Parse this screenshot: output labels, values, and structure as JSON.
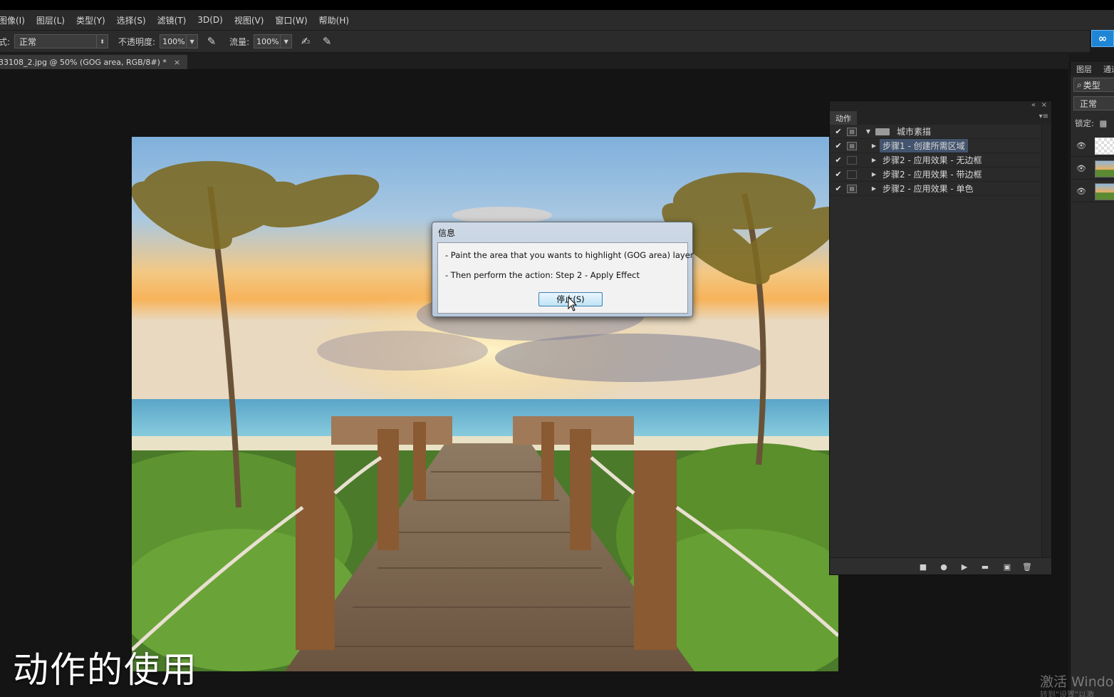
{
  "menu": [
    "图像(I)",
    "图层(L)",
    "类型(Y)",
    "选择(S)",
    "滤镜(T)",
    "3D(D)",
    "视图(V)",
    "窗口(W)",
    "帮助(H)"
  ],
  "options": {
    "mode_label": "式:",
    "mode_value": "正常",
    "opacity_label": "不透明度:",
    "opacity_value": "100%",
    "flow_label": "流量:",
    "flow_value": "100%"
  },
  "document_tab": {
    "title": "33108_2.jpg @ 50% (GOG area, RGB/8#) *",
    "close": "×"
  },
  "dialog": {
    "title": "信息",
    "line1": "- Paint the area that you wants to highlight (GOG area) layer",
    "line2": "- Then perform the action: Step 2 - Apply Effect",
    "button": "停止(S)"
  },
  "actions_panel": {
    "tab": "动作",
    "folder": "城市素描",
    "items": [
      {
        "label": "步骤1 - 创建所需区域",
        "dialog": true,
        "selected": true
      },
      {
        "label": "步骤2 - 应用效果 - 无边框",
        "dialog": false,
        "selected": false
      },
      {
        "label": "步骤2 - 应用效果 - 带边框",
        "dialog": false,
        "selected": false
      },
      {
        "label": "步骤2 - 应用效果 - 单色",
        "dialog": true,
        "selected": false
      }
    ]
  },
  "layers_panel": {
    "tab1": "图层",
    "tab2": "通道",
    "filter": "类型",
    "blend": "正常",
    "lock": "锁定:"
  },
  "caption": "动作的使用",
  "watermark": "激活 Windo",
  "watermark2": "转到\"设置\"以激",
  "colors": {
    "accent_selected": "#43546e",
    "dialog_button": "#bfe3f7",
    "cloud_button": "#1f86d6"
  }
}
